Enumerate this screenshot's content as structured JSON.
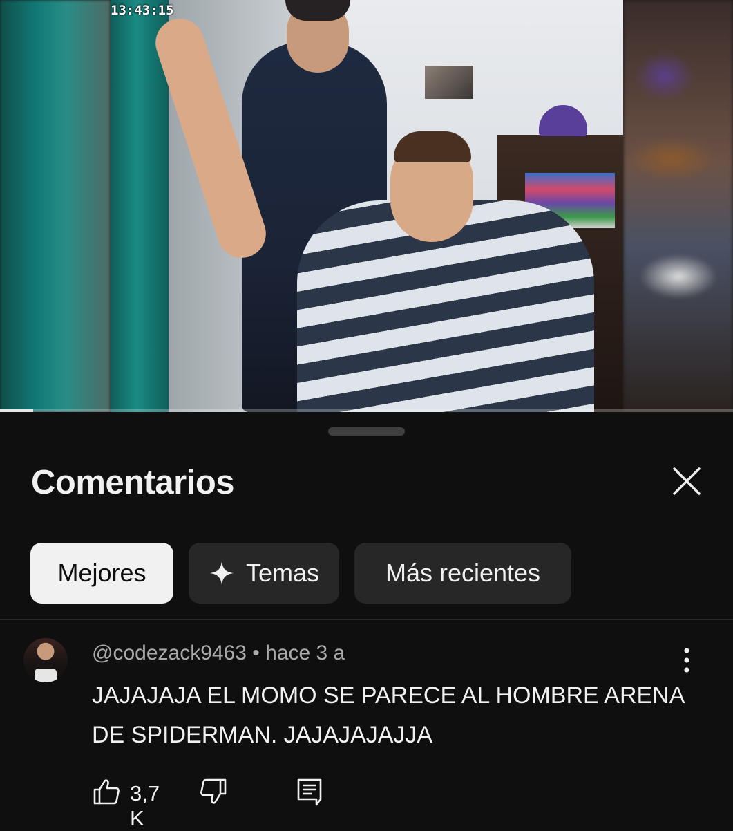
{
  "video": {
    "timestamp": "13:43:15",
    "progress_fraction": 0.045
  },
  "comments_sheet": {
    "title": "Comentarios",
    "close_icon": "close-icon",
    "chips": [
      {
        "label": "Mejores",
        "selected": true
      },
      {
        "label": "Temas",
        "icon": "sparkle-icon",
        "selected": false
      },
      {
        "label": "Más recientes",
        "selected": false
      }
    ]
  },
  "comment": {
    "author": "@codezack9463",
    "separator": "•",
    "time": "hace 3 a",
    "text": "JAJAJAJA EL MOMO SE PARECE AL HOMBRE ARENA DE SPIDERMAN. JAJAJAJAJJA",
    "likes": "3,7 K",
    "icons": {
      "like": "thumbs-up-icon",
      "dislike": "thumbs-down-icon",
      "reply": "reply-icon",
      "more": "more-vert-icon"
    }
  },
  "colors": {
    "background": "#0f0f0f",
    "chip_active_bg": "#f1f1f1",
    "chip_inactive_bg": "#272727",
    "secondary_text": "#aaaaaa"
  }
}
